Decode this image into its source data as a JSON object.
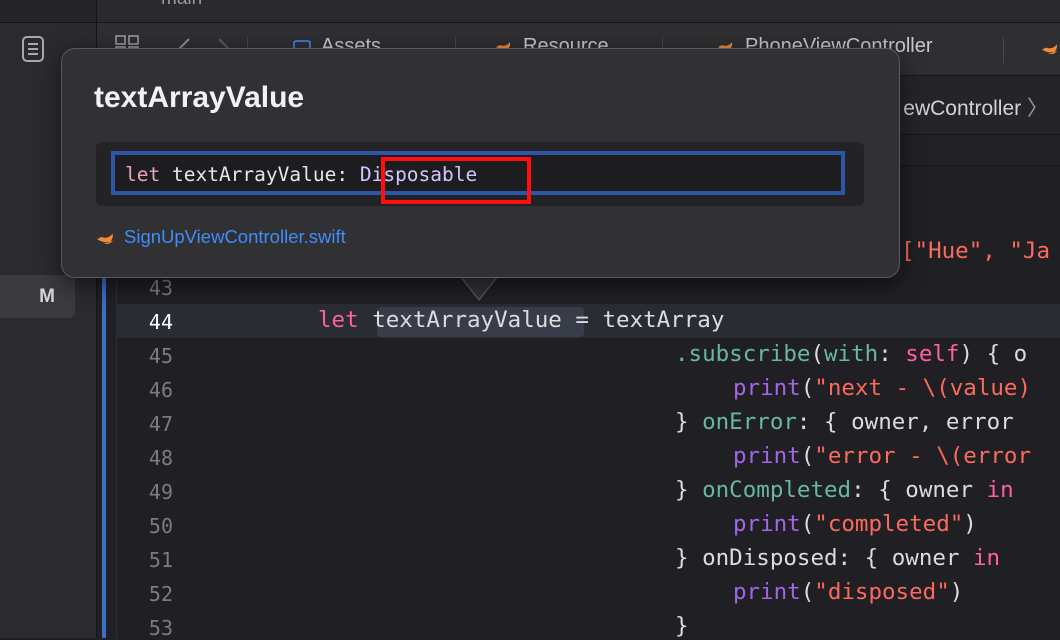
{
  "window": {
    "branch": "main"
  },
  "navigator": {
    "icon": "list-document-icon",
    "badge": "M"
  },
  "tabs": [
    {
      "label": "Assets",
      "icon": "asset-catalog-icon"
    },
    {
      "label": "Resource",
      "icon": "swift-file-icon"
    },
    {
      "label": "PhoneViewController",
      "icon": "swift-file-icon"
    }
  ],
  "jump_bar": {
    "current": "ewController",
    "chevron": "〉"
  },
  "popover": {
    "title": "textArrayValue",
    "declaration": {
      "keyword": "let",
      "name": "textArrayValue:",
      "type": "Disposable"
    },
    "file": "SignUpViewController.swift",
    "file_icon": "swift-file-icon",
    "partial_line_text": "[\"Hue\", \"Ja"
  },
  "editor": {
    "current_line": "44",
    "lines": [
      {
        "number": "43",
        "tokens": []
      },
      {
        "number": "44",
        "tokens": [
          "let",
          "textArrayValue",
          " = textArray"
        ]
      },
      {
        "number": "45",
        "tokens": [
          ".subscribe",
          "(",
          "with",
          ": ",
          "self",
          ") { o"
        ]
      },
      {
        "number": "46",
        "tokens": [
          "print",
          "(",
          "\"next - \\(value)",
          ""
        ]
      },
      {
        "number": "47",
        "tokens": [
          "} ",
          "onError",
          ": { owner, error"
        ]
      },
      {
        "number": "48",
        "tokens": [
          "print",
          "(",
          "\"error - \\(error"
        ]
      },
      {
        "number": "49",
        "tokens": [
          "} ",
          "onCompleted",
          ": { owner ",
          "in"
        ]
      },
      {
        "number": "50",
        "tokens": [
          "print",
          "(",
          "\"completed\"",
          ")"
        ]
      },
      {
        "number": "51",
        "tokens": [
          "} onDisposed: { owner ",
          "in"
        ]
      },
      {
        "number": "52",
        "tokens": [
          "print",
          "(",
          "\"disposed\"",
          ")"
        ]
      },
      {
        "number": "53",
        "tokens": [
          "}"
        ]
      }
    ]
  },
  "colors": {
    "keyword": "#fc5fa3",
    "string": "#fc6a5d",
    "function": "#a167e6",
    "member": "#67b7a4",
    "link": "#3f8dfb",
    "highlight_box": "#ff1010",
    "declaration_frame": "#2d56a8"
  }
}
